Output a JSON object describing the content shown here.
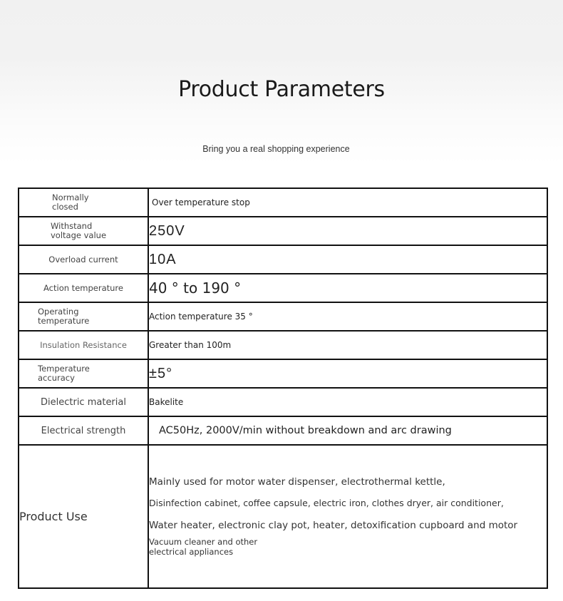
{
  "header": {
    "title": "Product Parameters",
    "subtitle": "Bring you a real shopping experience"
  },
  "table": {
    "rows": [
      {
        "label": "Normally closed",
        "value": "Over temperature stop"
      },
      {
        "label": "Withstand voltage value",
        "value": "250V"
      },
      {
        "label": "Overload current",
        "value": "10A"
      },
      {
        "label": "Action temperature",
        "value": "40 ° to 190 °"
      },
      {
        "label": "Operating temperature",
        "value": "Action temperature 35 °"
      },
      {
        "label": "Insulation Resistance",
        "value": "Greater than 100m"
      },
      {
        "label": "Temperature accuracy",
        "value": "±5°"
      },
      {
        "label": "Dielectric material",
        "value": "Bakelite"
      },
      {
        "label": "Electrical strength",
        "value": "AC50Hz, 2000V/min without breakdown and arc drawing"
      }
    ],
    "product_use": {
      "label": "Product Use",
      "lines": [
        "Mainly used for motor water dispenser, electrothermal kettle,",
        "Disinfection cabinet, coffee capsule, electric iron, clothes dryer, air conditioner,",
        "Water heater, electronic clay pot, heater, detoxification cupboard and motor",
        "Vacuum cleaner and other electrical appliances"
      ]
    }
  }
}
